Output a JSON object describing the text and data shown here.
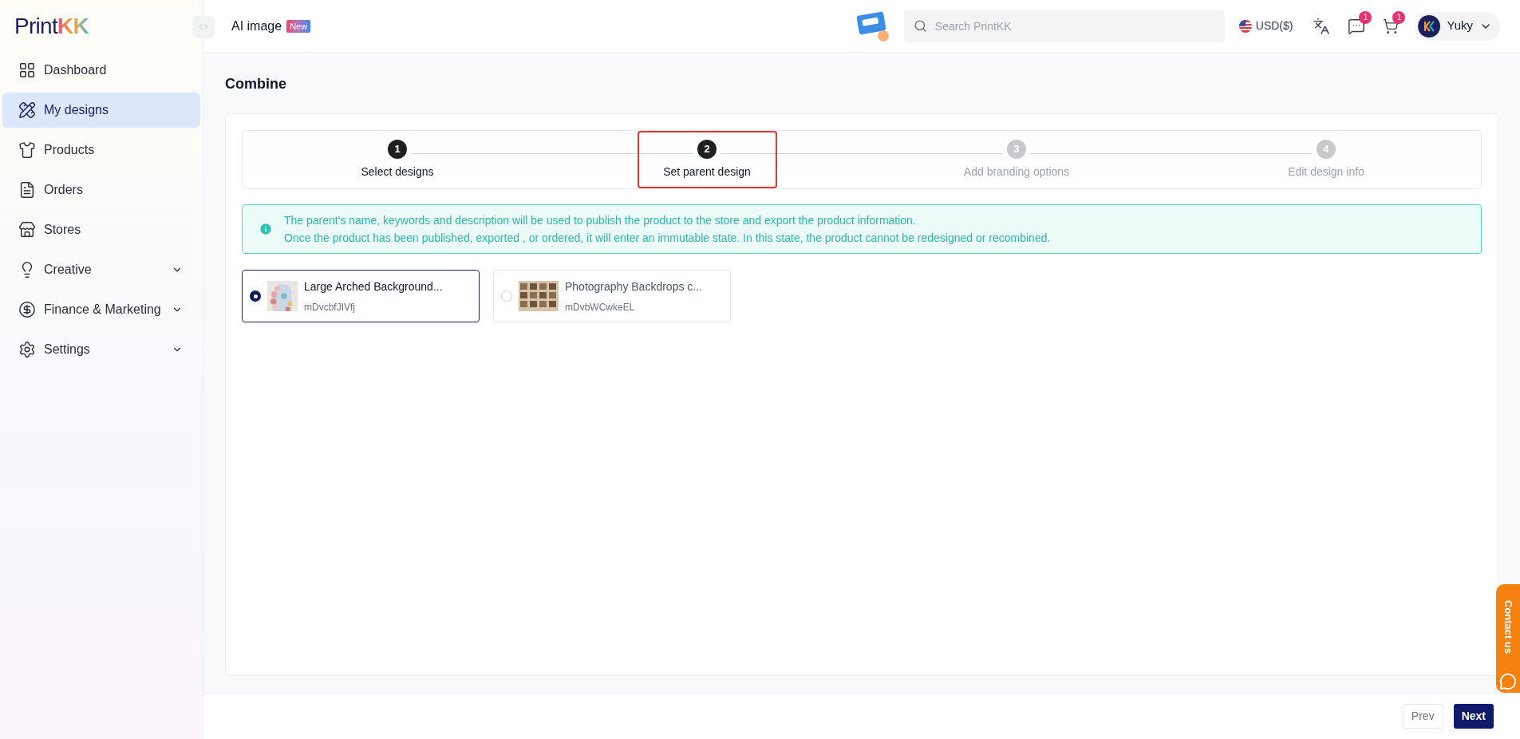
{
  "logo": {
    "text": "Print",
    "accent": "KK"
  },
  "topbar": {
    "title": "AI image",
    "badge": "New",
    "search": {
      "placeholder": "Search PrintKK"
    },
    "currency": "USD($)",
    "messages_count": "1",
    "cart_count": "1",
    "user": "Yuky"
  },
  "sidebar": {
    "items": [
      {
        "label": "Dashboard",
        "selected": false,
        "expandable": false
      },
      {
        "label": "My designs",
        "selected": true,
        "expandable": false
      },
      {
        "label": "Products",
        "selected": false,
        "expandable": false
      },
      {
        "label": "Orders",
        "selected": false,
        "expandable": false
      },
      {
        "label": "Stores",
        "selected": false,
        "expandable": false
      },
      {
        "label": "Creative",
        "selected": false,
        "expandable": true
      },
      {
        "label": "Finance & Marketing",
        "selected": false,
        "expandable": true
      },
      {
        "label": "Settings",
        "selected": false,
        "expandable": true
      }
    ]
  },
  "page": {
    "title": "Combine"
  },
  "steps": [
    {
      "number": "1",
      "label": "Select designs",
      "active": true,
      "highlighted": false
    },
    {
      "number": "2",
      "label": "Set parent design",
      "active": true,
      "highlighted": true
    },
    {
      "number": "3",
      "label": "Add branding options",
      "active": false,
      "highlighted": false
    },
    {
      "number": "4",
      "label": "Edit design info",
      "active": false,
      "highlighted": false
    }
  ],
  "notice": {
    "lines": [
      "The parent's name, keywords and description will be used to publish the product to the store and export the product information.",
      "Once the product has been published, exported , or ordered, it will enter an immutable state. In this state, the product cannot be redesigned or recombined."
    ]
  },
  "designs": [
    {
      "title": "Large Arched Background...",
      "code": "mDvcbfJIVfj",
      "selected": true
    },
    {
      "title": "Photography Backdrops c...",
      "code": "mDvbWCwkeEL",
      "selected": false
    }
  ],
  "footer": {
    "prev": "Prev",
    "next": "Next"
  },
  "contact": {
    "label": "Contact us"
  }
}
